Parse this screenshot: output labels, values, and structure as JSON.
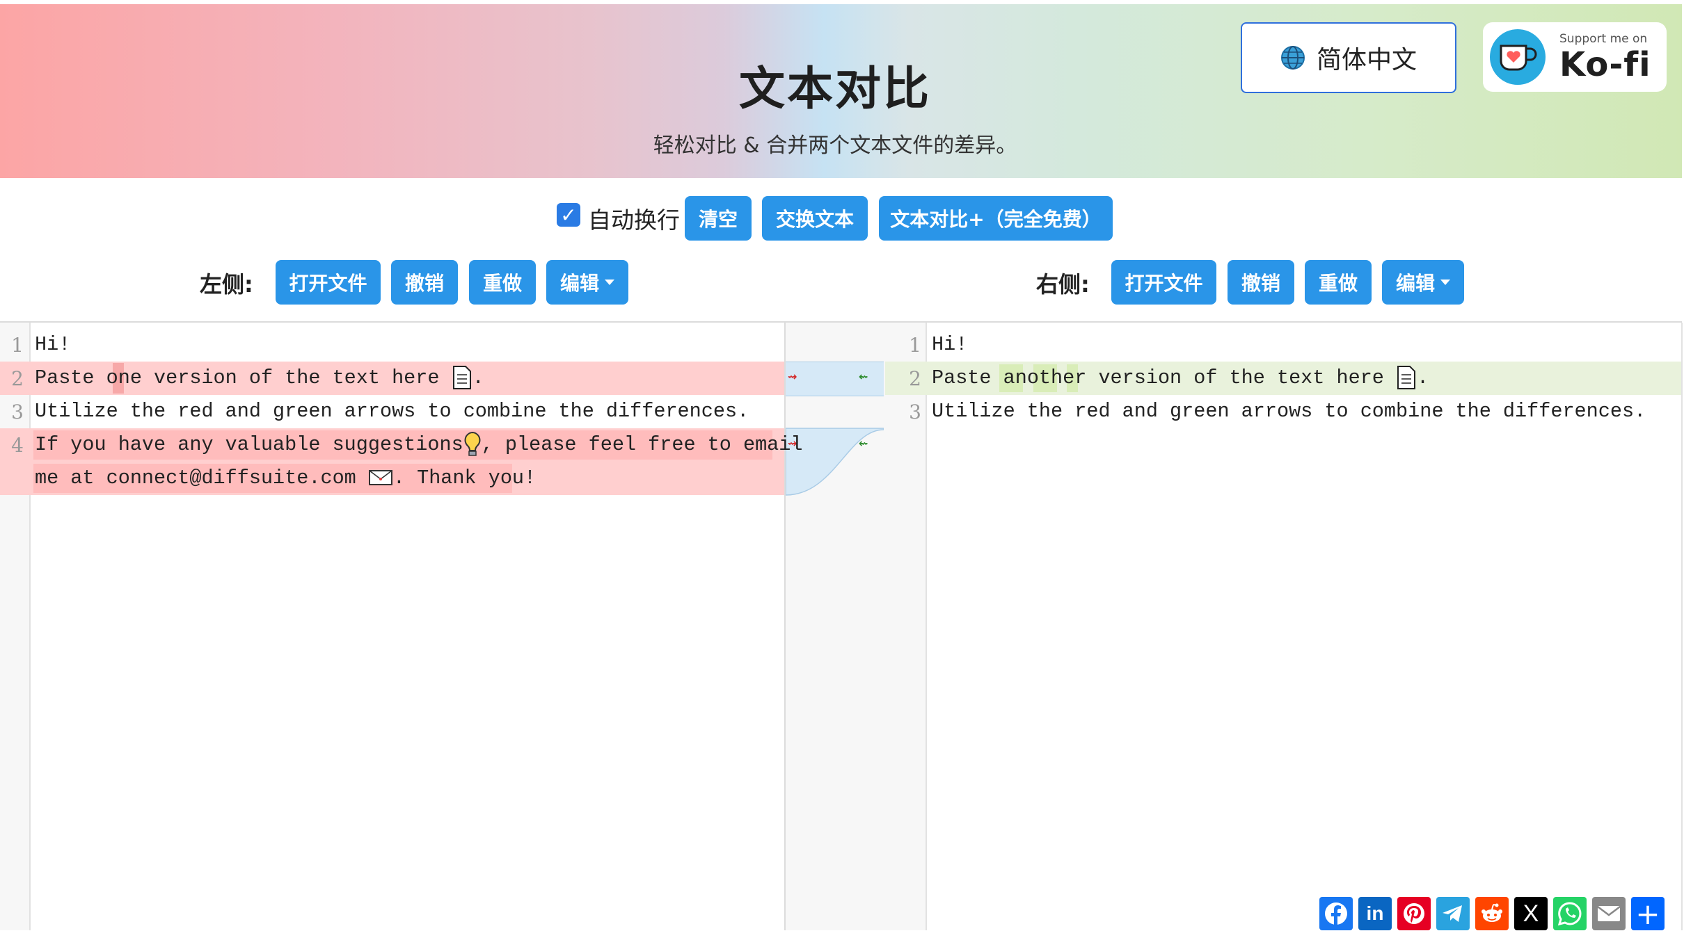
{
  "header": {
    "title": "文本对比",
    "subtitle": "轻松对比 & 合并两个文本文件的差异。",
    "language_button": "简体中文",
    "kofi_small": "Support me on",
    "kofi_big": "Ko-fi"
  },
  "toolbar": {
    "wrap_label": "自动换行",
    "wrap_checked": true,
    "clear": "清空",
    "swap": "交换文本",
    "plus": "文本对比+（完全免费）"
  },
  "left": {
    "label": "左侧:",
    "open": "打开文件",
    "undo": "撤销",
    "redo": "重做",
    "edit": "编辑",
    "lines": [
      {
        "n": "1",
        "text": "Hi!"
      },
      {
        "n": "2",
        "text": "Paste one version of the text here"
      },
      {
        "n": "3",
        "text": "Utilize the red and green arrows to combine the differences."
      },
      {
        "n": "4",
        "text": "If you have any valuable suggestions",
        "text2": ", please feel free to email",
        "text3": "me at connect@diffsuite.com",
        "text4": ". Thank you!"
      }
    ]
  },
  "right": {
    "label": "右侧:",
    "open": "打开文件",
    "undo": "撤销",
    "redo": "重做",
    "edit": "编辑",
    "lines": [
      {
        "n": "1",
        "text": "Hi!"
      },
      {
        "n": "2",
        "text": "Paste another version of the text here"
      },
      {
        "n": "3",
        "text": "Utilize the red and green arrows to combine the differences."
      }
    ]
  },
  "share_icons": [
    "facebook-icon",
    "linkedin-icon",
    "pinterest-icon",
    "telegram-icon",
    "reddit-icon",
    "x-icon",
    "whatsapp-icon",
    "email-icon",
    "share-plus-icon"
  ],
  "colors": {
    "button": "#2a95e8",
    "deleted": "#ffcfcf",
    "inserted": "#e9f2dc"
  }
}
